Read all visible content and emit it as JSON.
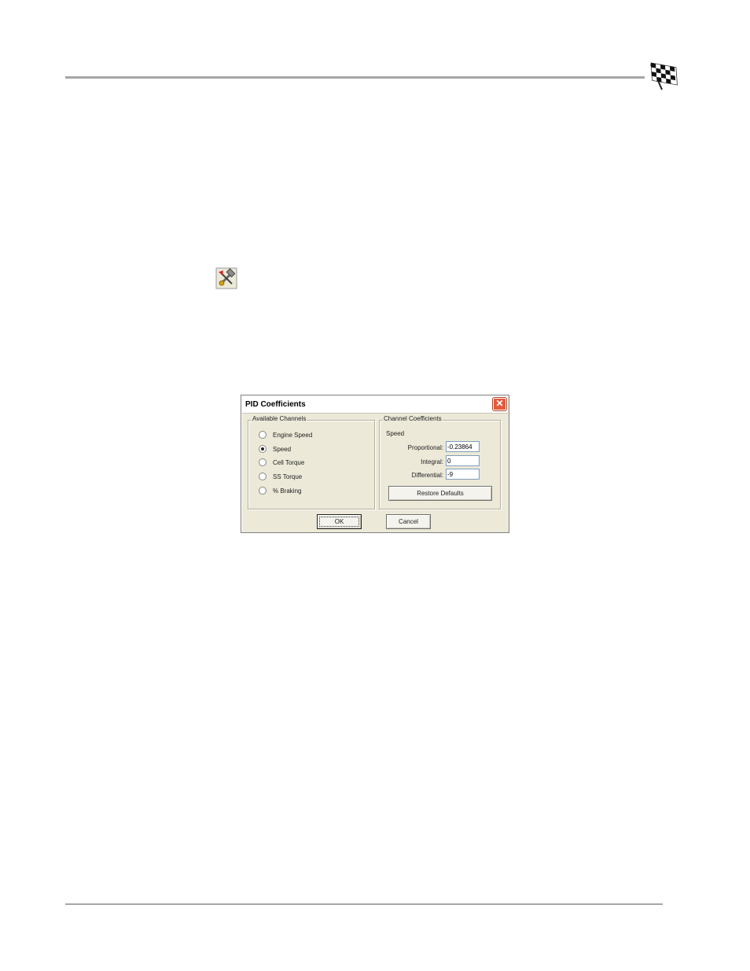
{
  "icons": {
    "header_flag": "checkered-flag-icon",
    "toolbar_tool": "pid-tool-icon"
  },
  "colors": {
    "rule": "#a6a6a6",
    "dialog_bg": "#ece9d8",
    "close_button": "#e25b3c"
  },
  "dialog": {
    "title": "PID Coefficients",
    "close_glyph": "✕",
    "available_channels": {
      "legend": "Available Channels",
      "selected": "Speed",
      "options": [
        {
          "label": "Engine Speed",
          "checked": false
        },
        {
          "label": "Speed",
          "checked": true
        },
        {
          "label": "Cell Torque",
          "checked": false
        },
        {
          "label": "SS Torque",
          "checked": false
        },
        {
          "label": "% Braking",
          "checked": false
        }
      ]
    },
    "channel_coefficients": {
      "legend": "Channel Coefficients",
      "channel_name": "Speed",
      "proportional_label": "Proportional:",
      "proportional_value": "-0.23864",
      "integral_label": "Integral:",
      "integral_value": "0",
      "differential_label": "Differential:",
      "differential_value": "-9",
      "restore_label": "Restore Defaults"
    },
    "ok_label": "OK",
    "cancel_label": "Cancel"
  }
}
